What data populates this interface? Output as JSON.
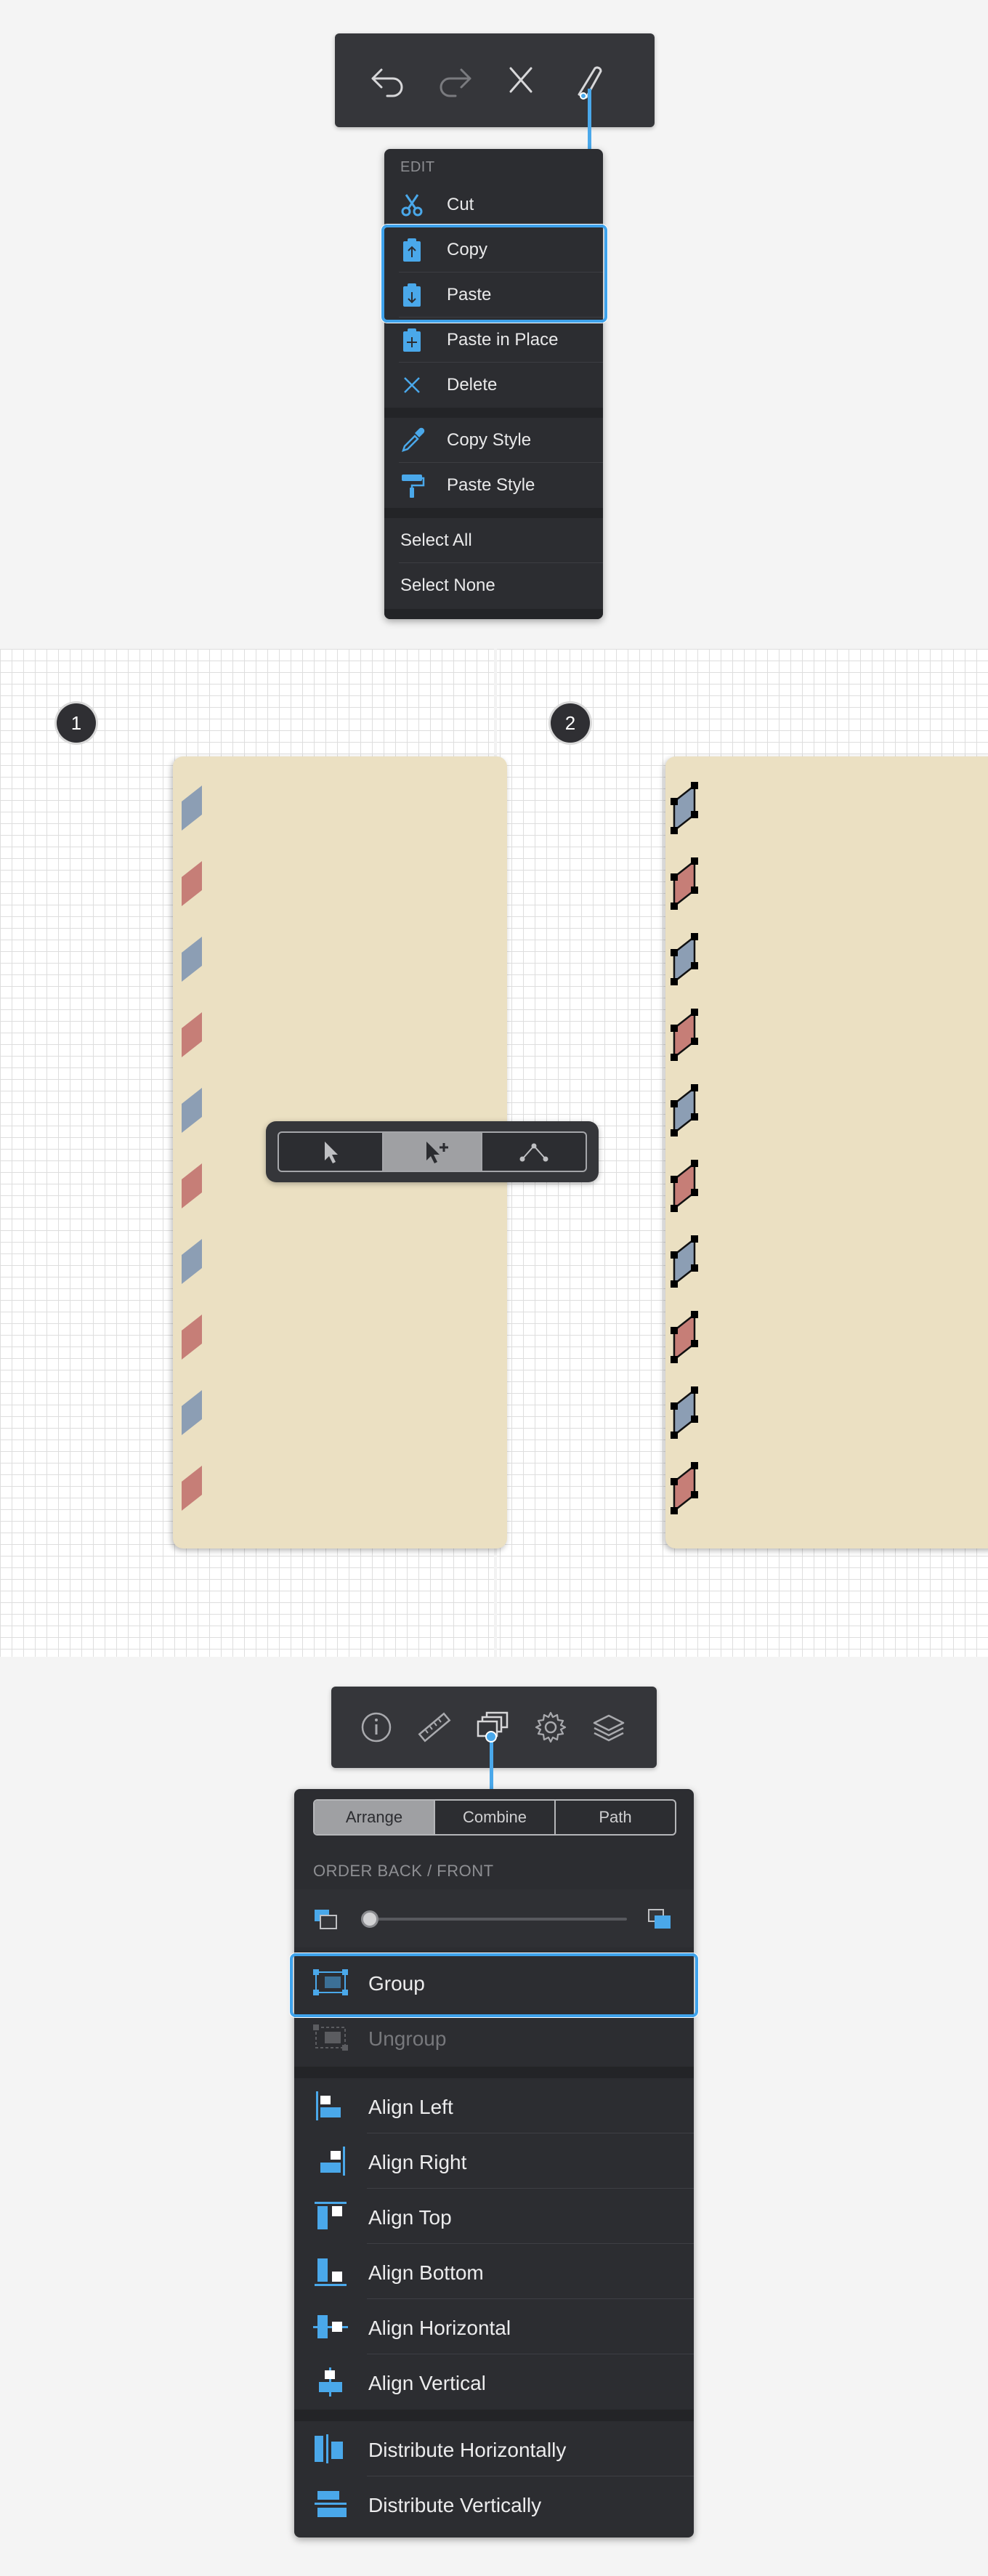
{
  "top_toolbar": {
    "buttons": [
      "undo-icon",
      "redo-icon",
      "close-icon",
      "edit-tool-icon"
    ]
  },
  "edit_menu": {
    "heading": "EDIT",
    "items": [
      {
        "label": "Cut",
        "icon": "scissors-icon"
      },
      {
        "label": "Copy",
        "icon": "clipboard-copy-icon"
      },
      {
        "label": "Paste",
        "icon": "clipboard-paste-icon"
      },
      {
        "label": "Paste in Place",
        "icon": "clipboard-paste-in-place-icon"
      },
      {
        "label": "Delete",
        "icon": "delete-x-icon"
      }
    ],
    "style_items": [
      {
        "label": "Copy Style",
        "icon": "eyedropper-icon"
      },
      {
        "label": "Paste Style",
        "icon": "paint-roller-icon"
      }
    ],
    "selection_items": [
      {
        "label": "Select All"
      },
      {
        "label": "Select None"
      }
    ],
    "highlighted": [
      "Copy",
      "Paste"
    ]
  },
  "canvas": {
    "steps": [
      {
        "number": "1"
      },
      {
        "number": "2"
      }
    ],
    "mode_bar": {
      "modes": [
        "select-arrow-icon",
        "multi-select-arrow-icon",
        "node-edit-icon"
      ],
      "active": "multi-select-arrow-icon"
    },
    "colors": {
      "envelope": "#ebe0c2",
      "stripe_blue": "#8c9eb4",
      "stripe_red": "#c67e77"
    }
  },
  "bottom_toolbar": {
    "buttons": [
      "info-icon",
      "ruler-icon",
      "arrange-icon",
      "settings-gear-icon",
      "layers-icon"
    ],
    "active": "arrange-icon"
  },
  "arrange_panel": {
    "tabs": [
      "Arrange",
      "Combine",
      "Path"
    ],
    "active_tab": "Arrange",
    "order_heading": "ORDER BACK / FRONT",
    "order_slider_value": 0,
    "group_items": [
      {
        "label": "Group",
        "enabled": true
      },
      {
        "label": "Ungroup",
        "enabled": false
      }
    ],
    "align_items": [
      {
        "label": "Align Left"
      },
      {
        "label": "Align Right"
      },
      {
        "label": "Align Top"
      },
      {
        "label": "Align Bottom"
      },
      {
        "label": "Align Horizontal"
      },
      {
        "label": "Align Vertical"
      }
    ],
    "distribute_items": [
      {
        "label": "Distribute Horizontally"
      },
      {
        "label": "Distribute Vertically"
      }
    ],
    "highlighted": "Group"
  },
  "colors": {
    "accent": "#3fa3ec",
    "panel_bg": "#2c2d31",
    "toolbar_bg": "#35363a"
  }
}
